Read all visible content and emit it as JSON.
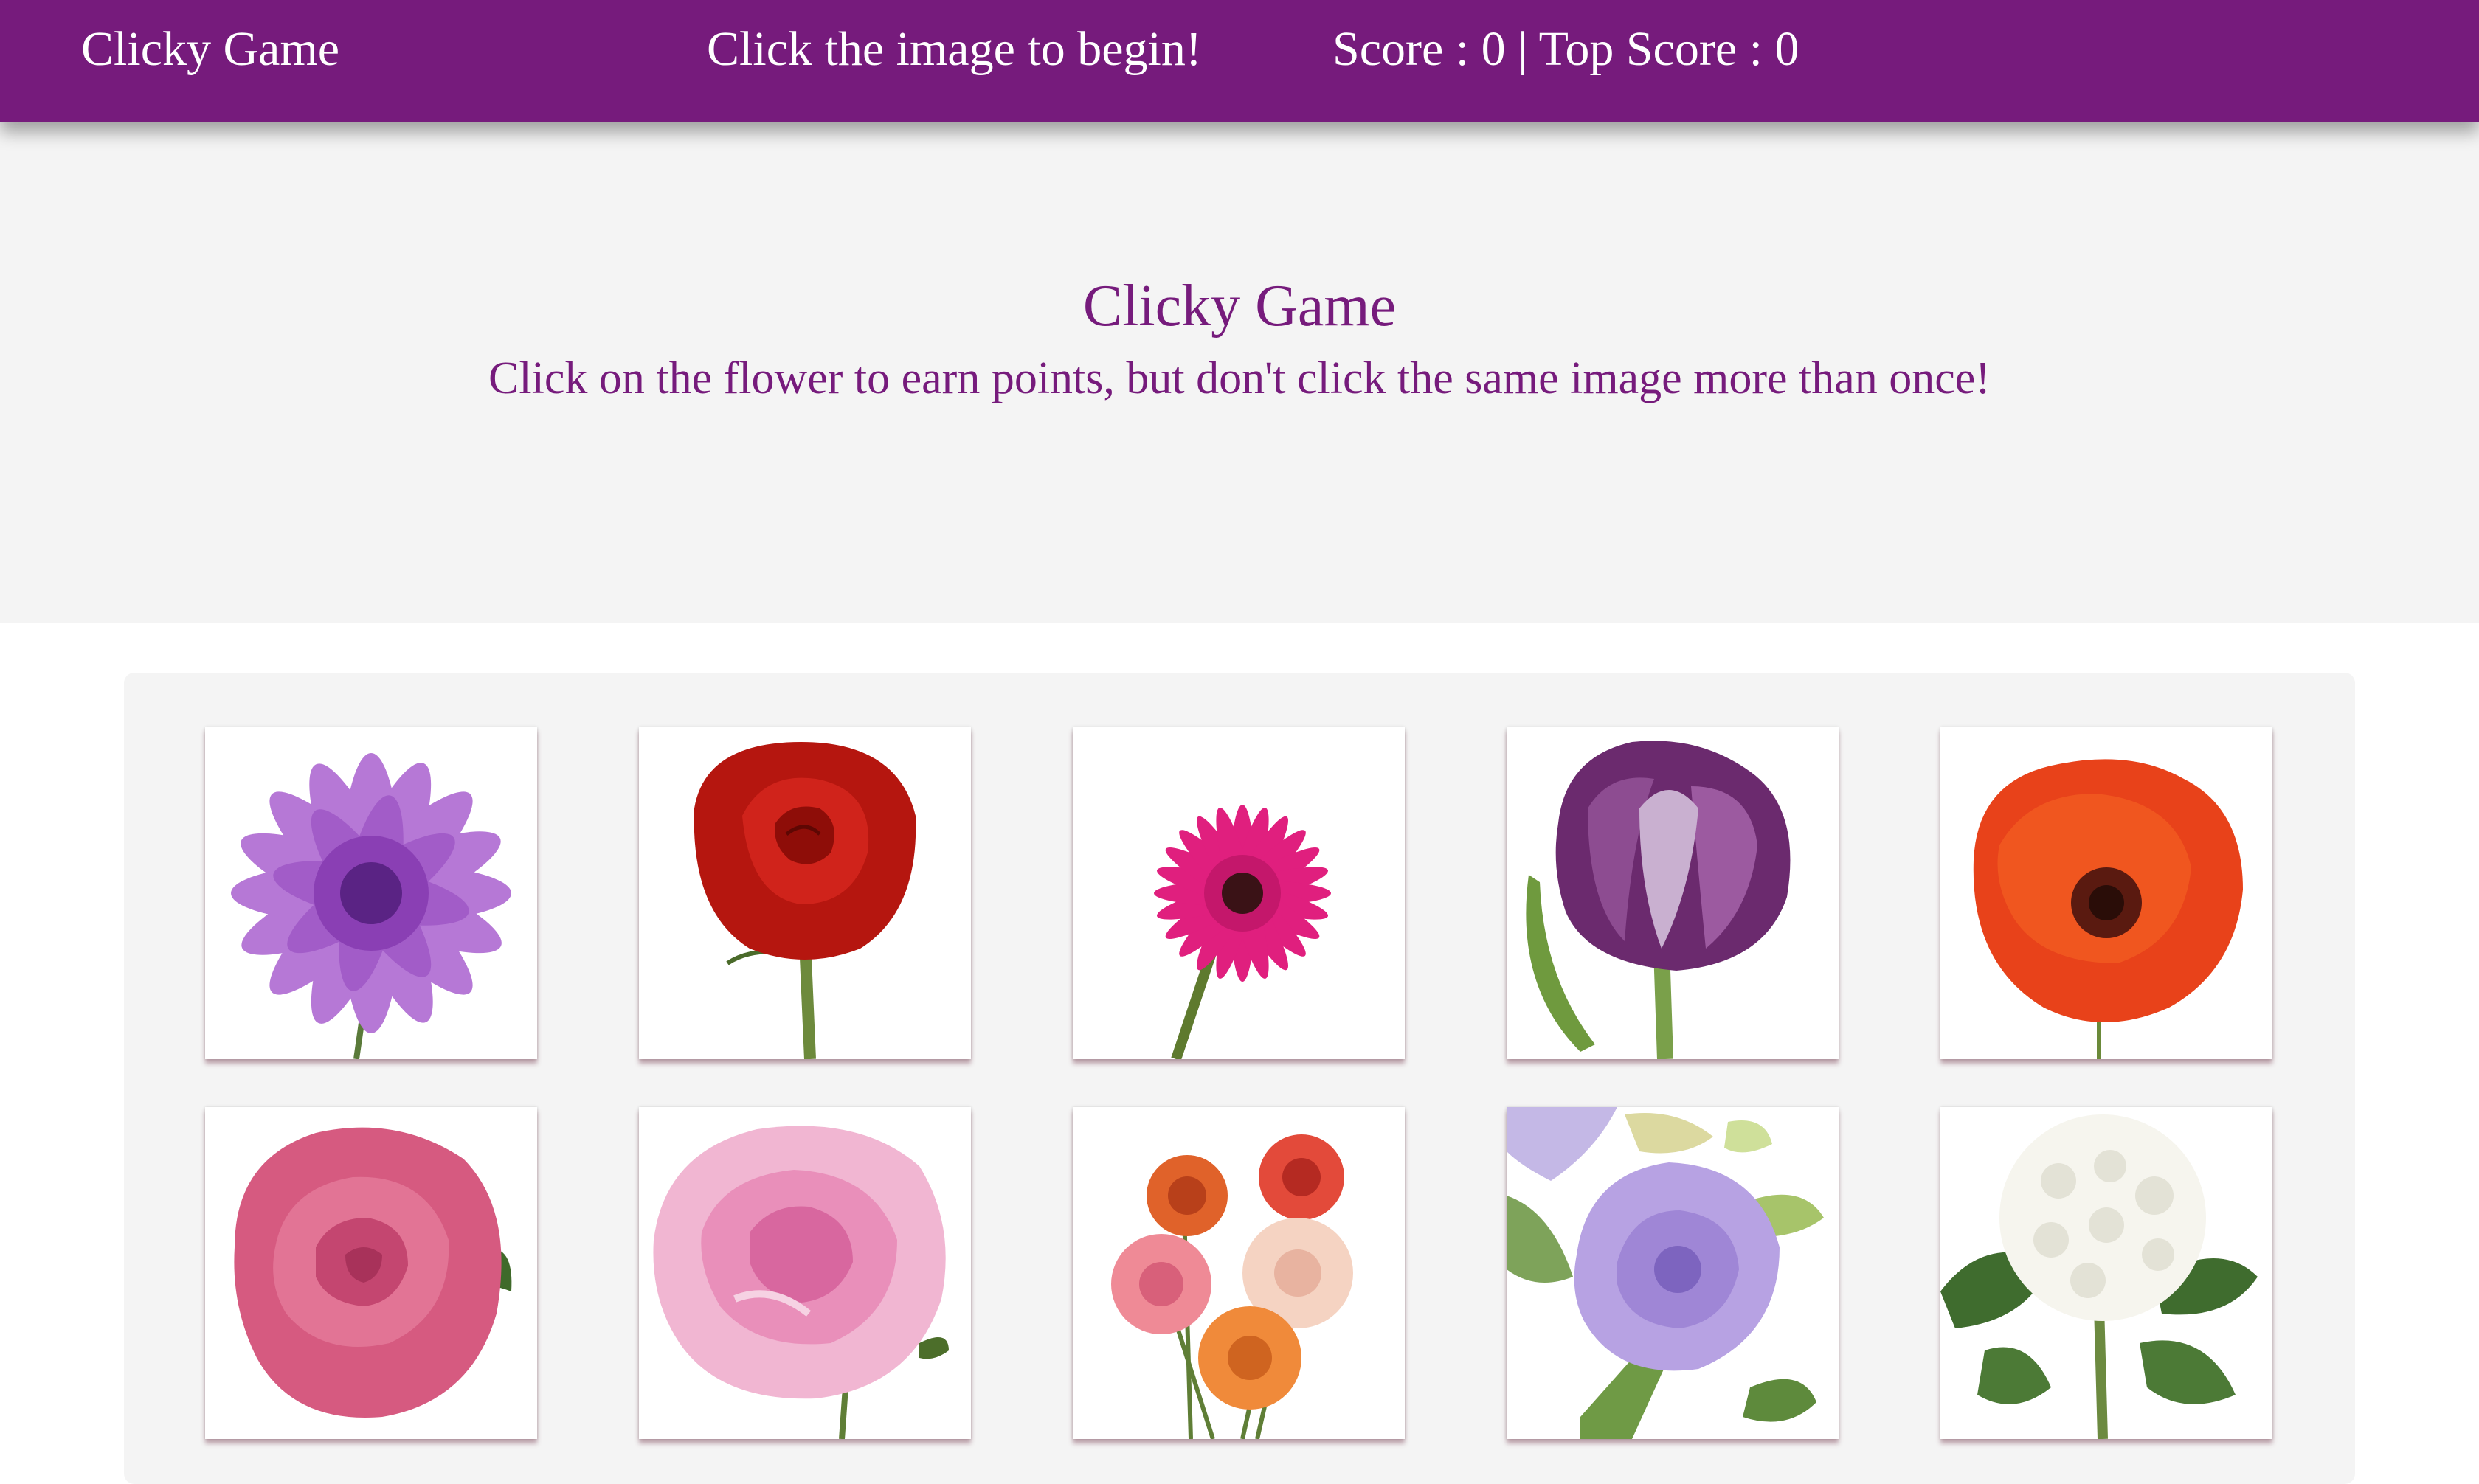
{
  "navbar": {
    "brand": "Clicky Game",
    "message": "Click the image to begin!",
    "score_text": "Score : 0 | Top Score : 0"
  },
  "jumbotron": {
    "title": "Clicky Game",
    "subtitle": "Click on the flower to earn points, but don't click the same image more than once!"
  },
  "colors": {
    "brand": "#761b7c",
    "jumbotron_bg": "#f4f4f4",
    "card_bg": "#ffffff"
  },
  "cards": [
    {
      "flower": "purple dahlia",
      "icon": "purple-dahlia-image"
    },
    {
      "flower": "red rose",
      "icon": "red-rose-image"
    },
    {
      "flower": "pink gerbera daisy",
      "icon": "pink-gerbera-image"
    },
    {
      "flower": "purple parrot tulip",
      "icon": "purple-tulip-image"
    },
    {
      "flower": "red poppy",
      "icon": "red-poppy-image"
    },
    {
      "flower": "pink garden rose",
      "icon": "pink-rose-image"
    },
    {
      "flower": "pink peony",
      "icon": "pink-peony-image"
    },
    {
      "flower": "rose bouquet",
      "icon": "rose-bouquet-image"
    },
    {
      "flower": "lavender lisianthus",
      "icon": "lisianthus-image"
    },
    {
      "flower": "white hydrangea",
      "icon": "white-hydrangea-image"
    }
  ]
}
